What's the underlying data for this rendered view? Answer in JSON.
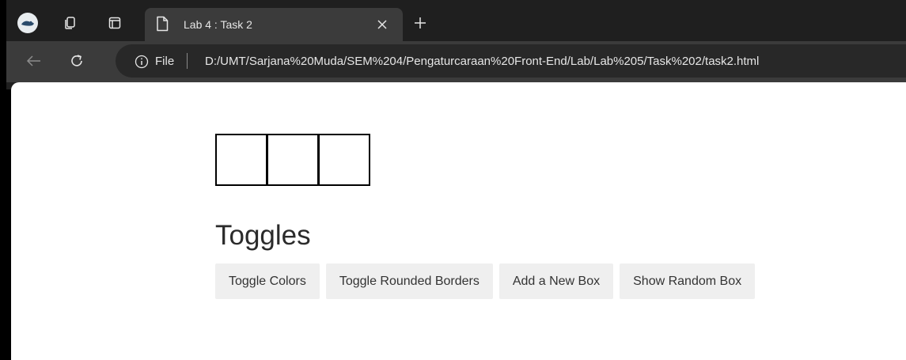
{
  "browser": {
    "tab": {
      "title": "Lab 4 : Task 2"
    },
    "address_bar": {
      "scheme_label": "File",
      "url": "D:/UMT/Sarjana%20Muda/SEM%204/Pengaturcaraan%20Front-End/Lab/Lab%205/Task%202/task2.html"
    },
    "icons": {
      "profile": "profile-avatar",
      "collections": "collections-icon",
      "tab_actions": "tab-actions-icon",
      "page": "page-icon",
      "close": "close-icon",
      "new_tab": "plus-icon",
      "back": "back-arrow-icon",
      "reload": "reload-icon",
      "info": "info-icon"
    }
  },
  "page": {
    "boxes": [
      {
        "color": "#ffffff"
      },
      {
        "color": "#ffffff"
      },
      {
        "color": "#ffffff"
      }
    ],
    "heading": "Toggles",
    "buttons": [
      {
        "label": "Toggle Colors"
      },
      {
        "label": "Toggle Rounded Borders"
      },
      {
        "label": "Add a New Box"
      },
      {
        "label": "Show Random Box"
      }
    ]
  },
  "colors": {
    "chrome_dark": "#1f1f1f",
    "toolbar": "#3b3b3b",
    "button_bg": "#efefef"
  }
}
